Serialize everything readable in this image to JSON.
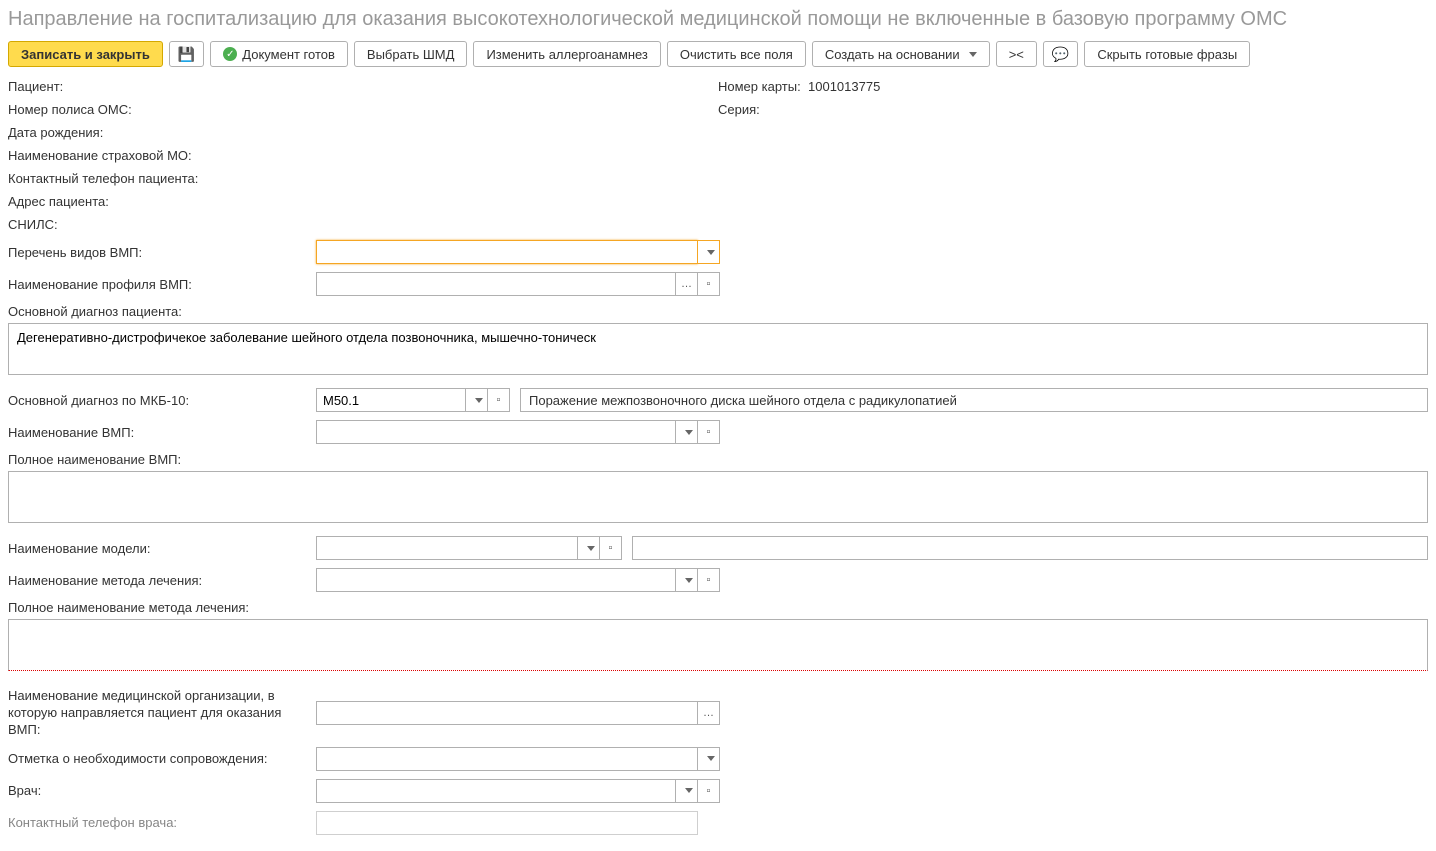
{
  "title": "Направление на госпитализацию для оказания высокотехнологической медицинской помощи не включенные в базовую программу ОМС",
  "toolbar": {
    "save_close": "Записать и закрыть",
    "doc_ready": "Документ готов",
    "select_shmd": "Выбрать ШМД",
    "change_allergo": "Изменить аллергоанамнез",
    "clear_all": "Очистить все поля",
    "create_based": "Создать на основании",
    "compare": "><",
    "hide_phrases": "Скрыть готовые фразы"
  },
  "header": {
    "patient_label": "Пациент:",
    "patient_value": "",
    "card_number_label": "Номер карты:",
    "card_number_value": "1001013775",
    "oms_policy_label": "Номер полиса ОМС:",
    "oms_policy_value": "",
    "series_label": "Серия:",
    "series_value": "",
    "birth_date_label": "Дата рождения:",
    "birth_date_value": "",
    "insurance_mo_label": "Наименование страховой МО:",
    "insurance_mo_value": "",
    "contact_phone_label": "Контактный телефон пациента:",
    "contact_phone_value": "",
    "address_label": "Адрес пациента:",
    "address_value": "",
    "snils_label": "СНИЛС:",
    "snils_value": ""
  },
  "form": {
    "vmp_types_label": "Перечень видов ВМП:",
    "vmp_types_value": "",
    "vmp_profile_label": "Наименование профиля ВМП:",
    "vmp_profile_value": "",
    "main_diagnosis_label": "Основной диагноз пациента:",
    "main_diagnosis_value": "Дегенеративно-дистрофичекое заболевание шейного отдела позвоночника, мышечно-тоническ",
    "mkb10_label": "Основной диагноз по МКБ-10:",
    "mkb10_code": "M50.1",
    "mkb10_desc": "Поражение  межпозвоночного диска шейного отдела с радикулопатией",
    "vmp_name_label": "Наименование ВМП:",
    "vmp_name_value": "",
    "vmp_full_name_label": "Полное наименование ВМП:",
    "vmp_full_name_value": "",
    "model_name_label": "Наименование модели:",
    "model_name_value": "",
    "model_extra_value": "",
    "treatment_method_label": "Наименование метода лечения:",
    "treatment_method_value": "",
    "treatment_full_label": "Полное наименование метода лечения:",
    "treatment_full_value": "",
    "org_label": "Наименование медицинской организации, в которую направляется пациент для оказания ВМП:",
    "org_value": "",
    "escort_label": "Отметка о необходимости сопровождения:",
    "escort_value": "",
    "doctor_label": "Врач:",
    "doctor_value": "",
    "doctor_phone_label": "Контактный телефон врача:",
    "doctor_phone_value": ""
  }
}
